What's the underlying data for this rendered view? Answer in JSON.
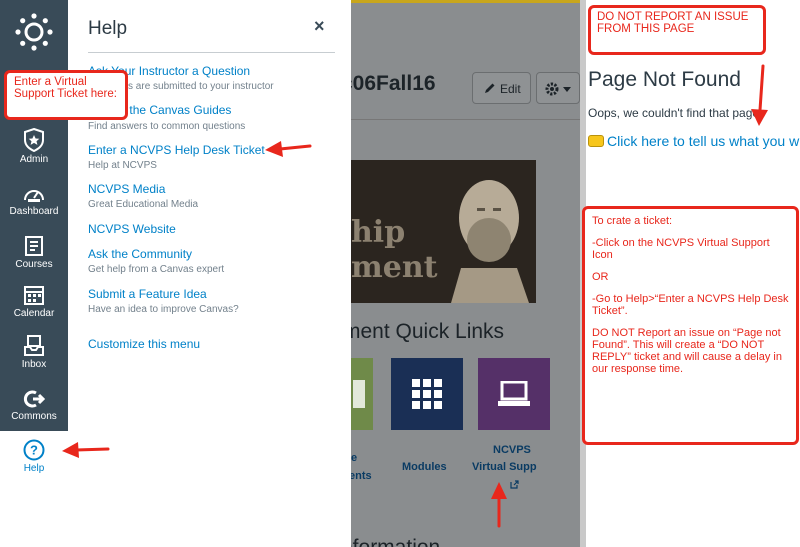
{
  "nav": {
    "items": [
      {
        "label": "Admin",
        "icon": "shield-star-icon"
      },
      {
        "label": "Dashboard",
        "icon": "speedometer-icon"
      },
      {
        "label": "Courses",
        "icon": "book-icon"
      },
      {
        "label": "Calendar",
        "icon": "calendar-icon"
      },
      {
        "label": "Inbox",
        "icon": "inbox-icon"
      },
      {
        "label": "Commons",
        "icon": "commons-icon"
      },
      {
        "label": "Help",
        "icon": "help-circle-icon"
      }
    ]
  },
  "help_tray": {
    "title": "Help",
    "close": "×",
    "links": [
      {
        "label": "Ask Your Instructor a Question",
        "desc": "Questions are submitted to your instructor"
      },
      {
        "label": "Search the Canvas Guides",
        "desc": "Find answers to common questions"
      },
      {
        "label": "Enter a NCVPS Help Desk Ticket",
        "desc": "Help at NCVPS"
      },
      {
        "label": "NCVPS Media",
        "desc": "Great Educational Media"
      },
      {
        "label": "NCVPS Website",
        "desc": ""
      },
      {
        "label": "Ask the Community",
        "desc": "Get help from a Canvas expert"
      },
      {
        "label": "Submit a Feature Idea",
        "desc": "Have an idea to improve Canvas?"
      },
      {
        "label": "Customize this menu",
        "desc": ""
      }
    ]
  },
  "course_page": {
    "course_title": "c06Fall16",
    "edit_label": "Edit",
    "banner_word_1": "hip",
    "banner_word_2": "ment",
    "quick_links_heading": "ment Quick Links",
    "tile_labels": {
      "modules": "Modules",
      "ncvps": "NCVPS",
      "virtual": "Virtual Supp",
      "left_1": "e",
      "left_2": "ents"
    },
    "bottom_heading": "nformation"
  },
  "not_found_page": {
    "heading": "Page Not Found",
    "message": "Oops, we couldn't find that page.",
    "report_link": "Click here to tell us what you w"
  },
  "annotations": {
    "top": "DO NOT REPORT AN ISSUE FROM THIS PAGE",
    "left": "Enter a Virtual Support Ticket here:",
    "instructions": [
      "To crate a ticket:",
      "-Click on the NCVPS Virtual Support Icon",
      "OR",
      "-Go to Help>“Enter a NCVPS Help Desk Ticket”.",
      "DO NOT Report an issue on “Page not Found”. This will create a “DO NOT REPLY” ticket and will cause a delay in our response time."
    ]
  },
  "colors": {
    "nav_bg": "#394b58",
    "link": "#0081c8",
    "annotation_red": "#e8271c",
    "tile_green": "#8bc34a",
    "tile_navy": "#1b3b73",
    "tile_purple": "#6c3b8c"
  }
}
